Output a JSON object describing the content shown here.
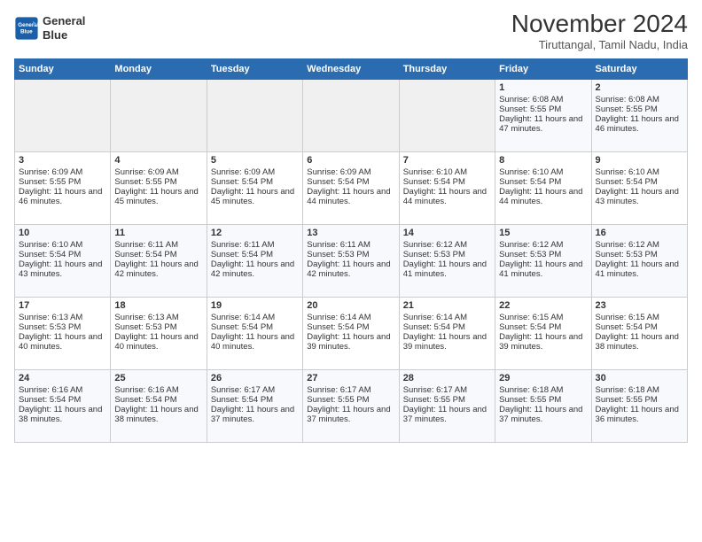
{
  "header": {
    "logo_line1": "General",
    "logo_line2": "Blue",
    "month_title": "November 2024",
    "location": "Tiruttangal, Tamil Nadu, India"
  },
  "days_of_week": [
    "Sunday",
    "Monday",
    "Tuesday",
    "Wednesday",
    "Thursday",
    "Friday",
    "Saturday"
  ],
  "weeks": [
    [
      {
        "day": "",
        "info": ""
      },
      {
        "day": "",
        "info": ""
      },
      {
        "day": "",
        "info": ""
      },
      {
        "day": "",
        "info": ""
      },
      {
        "day": "",
        "info": ""
      },
      {
        "day": "1",
        "info": "Sunrise: 6:08 AM\nSunset: 5:55 PM\nDaylight: 11 hours and 47 minutes."
      },
      {
        "day": "2",
        "info": "Sunrise: 6:08 AM\nSunset: 5:55 PM\nDaylight: 11 hours and 46 minutes."
      }
    ],
    [
      {
        "day": "3",
        "info": "Sunrise: 6:09 AM\nSunset: 5:55 PM\nDaylight: 11 hours and 46 minutes."
      },
      {
        "day": "4",
        "info": "Sunrise: 6:09 AM\nSunset: 5:55 PM\nDaylight: 11 hours and 45 minutes."
      },
      {
        "day": "5",
        "info": "Sunrise: 6:09 AM\nSunset: 5:54 PM\nDaylight: 11 hours and 45 minutes."
      },
      {
        "day": "6",
        "info": "Sunrise: 6:09 AM\nSunset: 5:54 PM\nDaylight: 11 hours and 44 minutes."
      },
      {
        "day": "7",
        "info": "Sunrise: 6:10 AM\nSunset: 5:54 PM\nDaylight: 11 hours and 44 minutes."
      },
      {
        "day": "8",
        "info": "Sunrise: 6:10 AM\nSunset: 5:54 PM\nDaylight: 11 hours and 44 minutes."
      },
      {
        "day": "9",
        "info": "Sunrise: 6:10 AM\nSunset: 5:54 PM\nDaylight: 11 hours and 43 minutes."
      }
    ],
    [
      {
        "day": "10",
        "info": "Sunrise: 6:10 AM\nSunset: 5:54 PM\nDaylight: 11 hours and 43 minutes."
      },
      {
        "day": "11",
        "info": "Sunrise: 6:11 AM\nSunset: 5:54 PM\nDaylight: 11 hours and 42 minutes."
      },
      {
        "day": "12",
        "info": "Sunrise: 6:11 AM\nSunset: 5:54 PM\nDaylight: 11 hours and 42 minutes."
      },
      {
        "day": "13",
        "info": "Sunrise: 6:11 AM\nSunset: 5:53 PM\nDaylight: 11 hours and 42 minutes."
      },
      {
        "day": "14",
        "info": "Sunrise: 6:12 AM\nSunset: 5:53 PM\nDaylight: 11 hours and 41 minutes."
      },
      {
        "day": "15",
        "info": "Sunrise: 6:12 AM\nSunset: 5:53 PM\nDaylight: 11 hours and 41 minutes."
      },
      {
        "day": "16",
        "info": "Sunrise: 6:12 AM\nSunset: 5:53 PM\nDaylight: 11 hours and 41 minutes."
      }
    ],
    [
      {
        "day": "17",
        "info": "Sunrise: 6:13 AM\nSunset: 5:53 PM\nDaylight: 11 hours and 40 minutes."
      },
      {
        "day": "18",
        "info": "Sunrise: 6:13 AM\nSunset: 5:53 PM\nDaylight: 11 hours and 40 minutes."
      },
      {
        "day": "19",
        "info": "Sunrise: 6:14 AM\nSunset: 5:54 PM\nDaylight: 11 hours and 40 minutes."
      },
      {
        "day": "20",
        "info": "Sunrise: 6:14 AM\nSunset: 5:54 PM\nDaylight: 11 hours and 39 minutes."
      },
      {
        "day": "21",
        "info": "Sunrise: 6:14 AM\nSunset: 5:54 PM\nDaylight: 11 hours and 39 minutes."
      },
      {
        "day": "22",
        "info": "Sunrise: 6:15 AM\nSunset: 5:54 PM\nDaylight: 11 hours and 39 minutes."
      },
      {
        "day": "23",
        "info": "Sunrise: 6:15 AM\nSunset: 5:54 PM\nDaylight: 11 hours and 38 minutes."
      }
    ],
    [
      {
        "day": "24",
        "info": "Sunrise: 6:16 AM\nSunset: 5:54 PM\nDaylight: 11 hours and 38 minutes."
      },
      {
        "day": "25",
        "info": "Sunrise: 6:16 AM\nSunset: 5:54 PM\nDaylight: 11 hours and 38 minutes."
      },
      {
        "day": "26",
        "info": "Sunrise: 6:17 AM\nSunset: 5:54 PM\nDaylight: 11 hours and 37 minutes."
      },
      {
        "day": "27",
        "info": "Sunrise: 6:17 AM\nSunset: 5:55 PM\nDaylight: 11 hours and 37 minutes."
      },
      {
        "day": "28",
        "info": "Sunrise: 6:17 AM\nSunset: 5:55 PM\nDaylight: 11 hours and 37 minutes."
      },
      {
        "day": "29",
        "info": "Sunrise: 6:18 AM\nSunset: 5:55 PM\nDaylight: 11 hours and 37 minutes."
      },
      {
        "day": "30",
        "info": "Sunrise: 6:18 AM\nSunset: 5:55 PM\nDaylight: 11 hours and 36 minutes."
      }
    ]
  ]
}
